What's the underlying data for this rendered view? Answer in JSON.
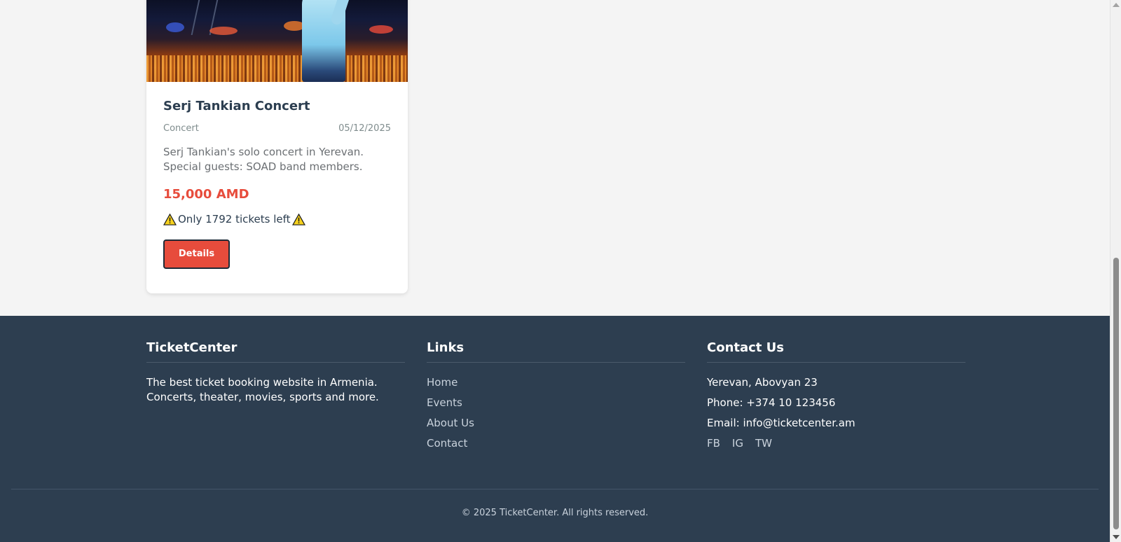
{
  "event_card": {
    "image_alt": "concert-stage-photo",
    "title": "Serj Tankian Concert",
    "category": "Concert",
    "date": "05/12/2025",
    "description": "Serj Tankian's solo concert in Yerevan. Special guests: SOAD band members.",
    "price": "15,000 AMD",
    "stock": "Only 1792 tickets left",
    "details_label": "Details",
    "accent_color": "#e74c3c"
  },
  "footer": {
    "brand": {
      "title": "TicketCenter",
      "text": "The best ticket booking website in Armenia. Concerts, theater, movies, sports and more."
    },
    "links": {
      "title": "Links",
      "items": [
        "Home",
        "Events",
        "About Us",
        "Contact"
      ]
    },
    "contact": {
      "title": "Contact Us",
      "address": "Yerevan, Abovyan 23",
      "phone": "Phone: +374 10 123456",
      "email": "Email: info@ticketcenter.am",
      "socials": [
        "FB",
        "IG",
        "TW"
      ]
    },
    "copyright": "© 2025 TicketCenter. All rights reserved.",
    "background": "#2d3e50"
  }
}
